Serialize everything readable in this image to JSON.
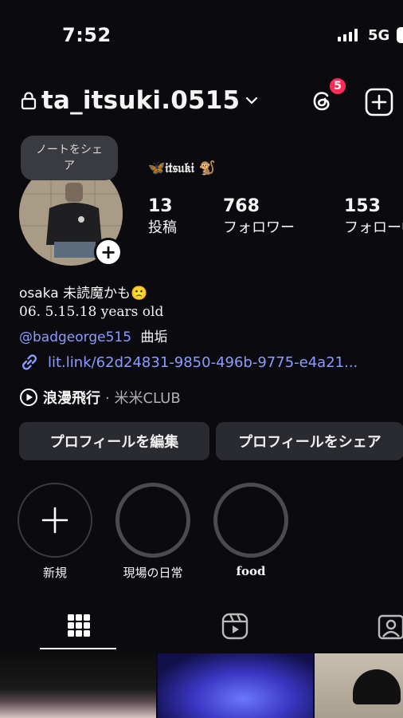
{
  "status_bar": {
    "time": "7:52",
    "network": "5G"
  },
  "header": {
    "username": "ta_itsuki.0515",
    "threads_badge": "5"
  },
  "profile": {
    "note_bubble": "ノートをシェア",
    "display_name": "🦋𝔦𝔱𝔰𝔲𝔨𝔦 🐒",
    "stats": [
      {
        "value": "13",
        "label": "投稿"
      },
      {
        "value": "768",
        "label": "フォロワー"
      },
      {
        "value": "153",
        "label": "フォロー中"
      }
    ],
    "bio_line1": "osaka 未読魔かも🙁",
    "bio_line2": "06. 5.15.18 years old",
    "mention": "@badgeorge515",
    "mention_suffix": "曲垢",
    "link": "lit.link/62d24831-9850-496b-9775-e4a21...",
    "music_title": "浪漫飛行",
    "music_artist": "· 米米CLUB"
  },
  "actions": {
    "edit_profile": "プロフィールを編集",
    "share_profile": "プロフィールをシェア"
  },
  "highlights": [
    {
      "label": "新規"
    },
    {
      "label": "現場の日常"
    },
    {
      "label": "food"
    }
  ],
  "colors": {
    "background": "#0b0b0f",
    "link": "#8a9cff",
    "badge": "#ff2d55",
    "button": "#2a2b30"
  }
}
